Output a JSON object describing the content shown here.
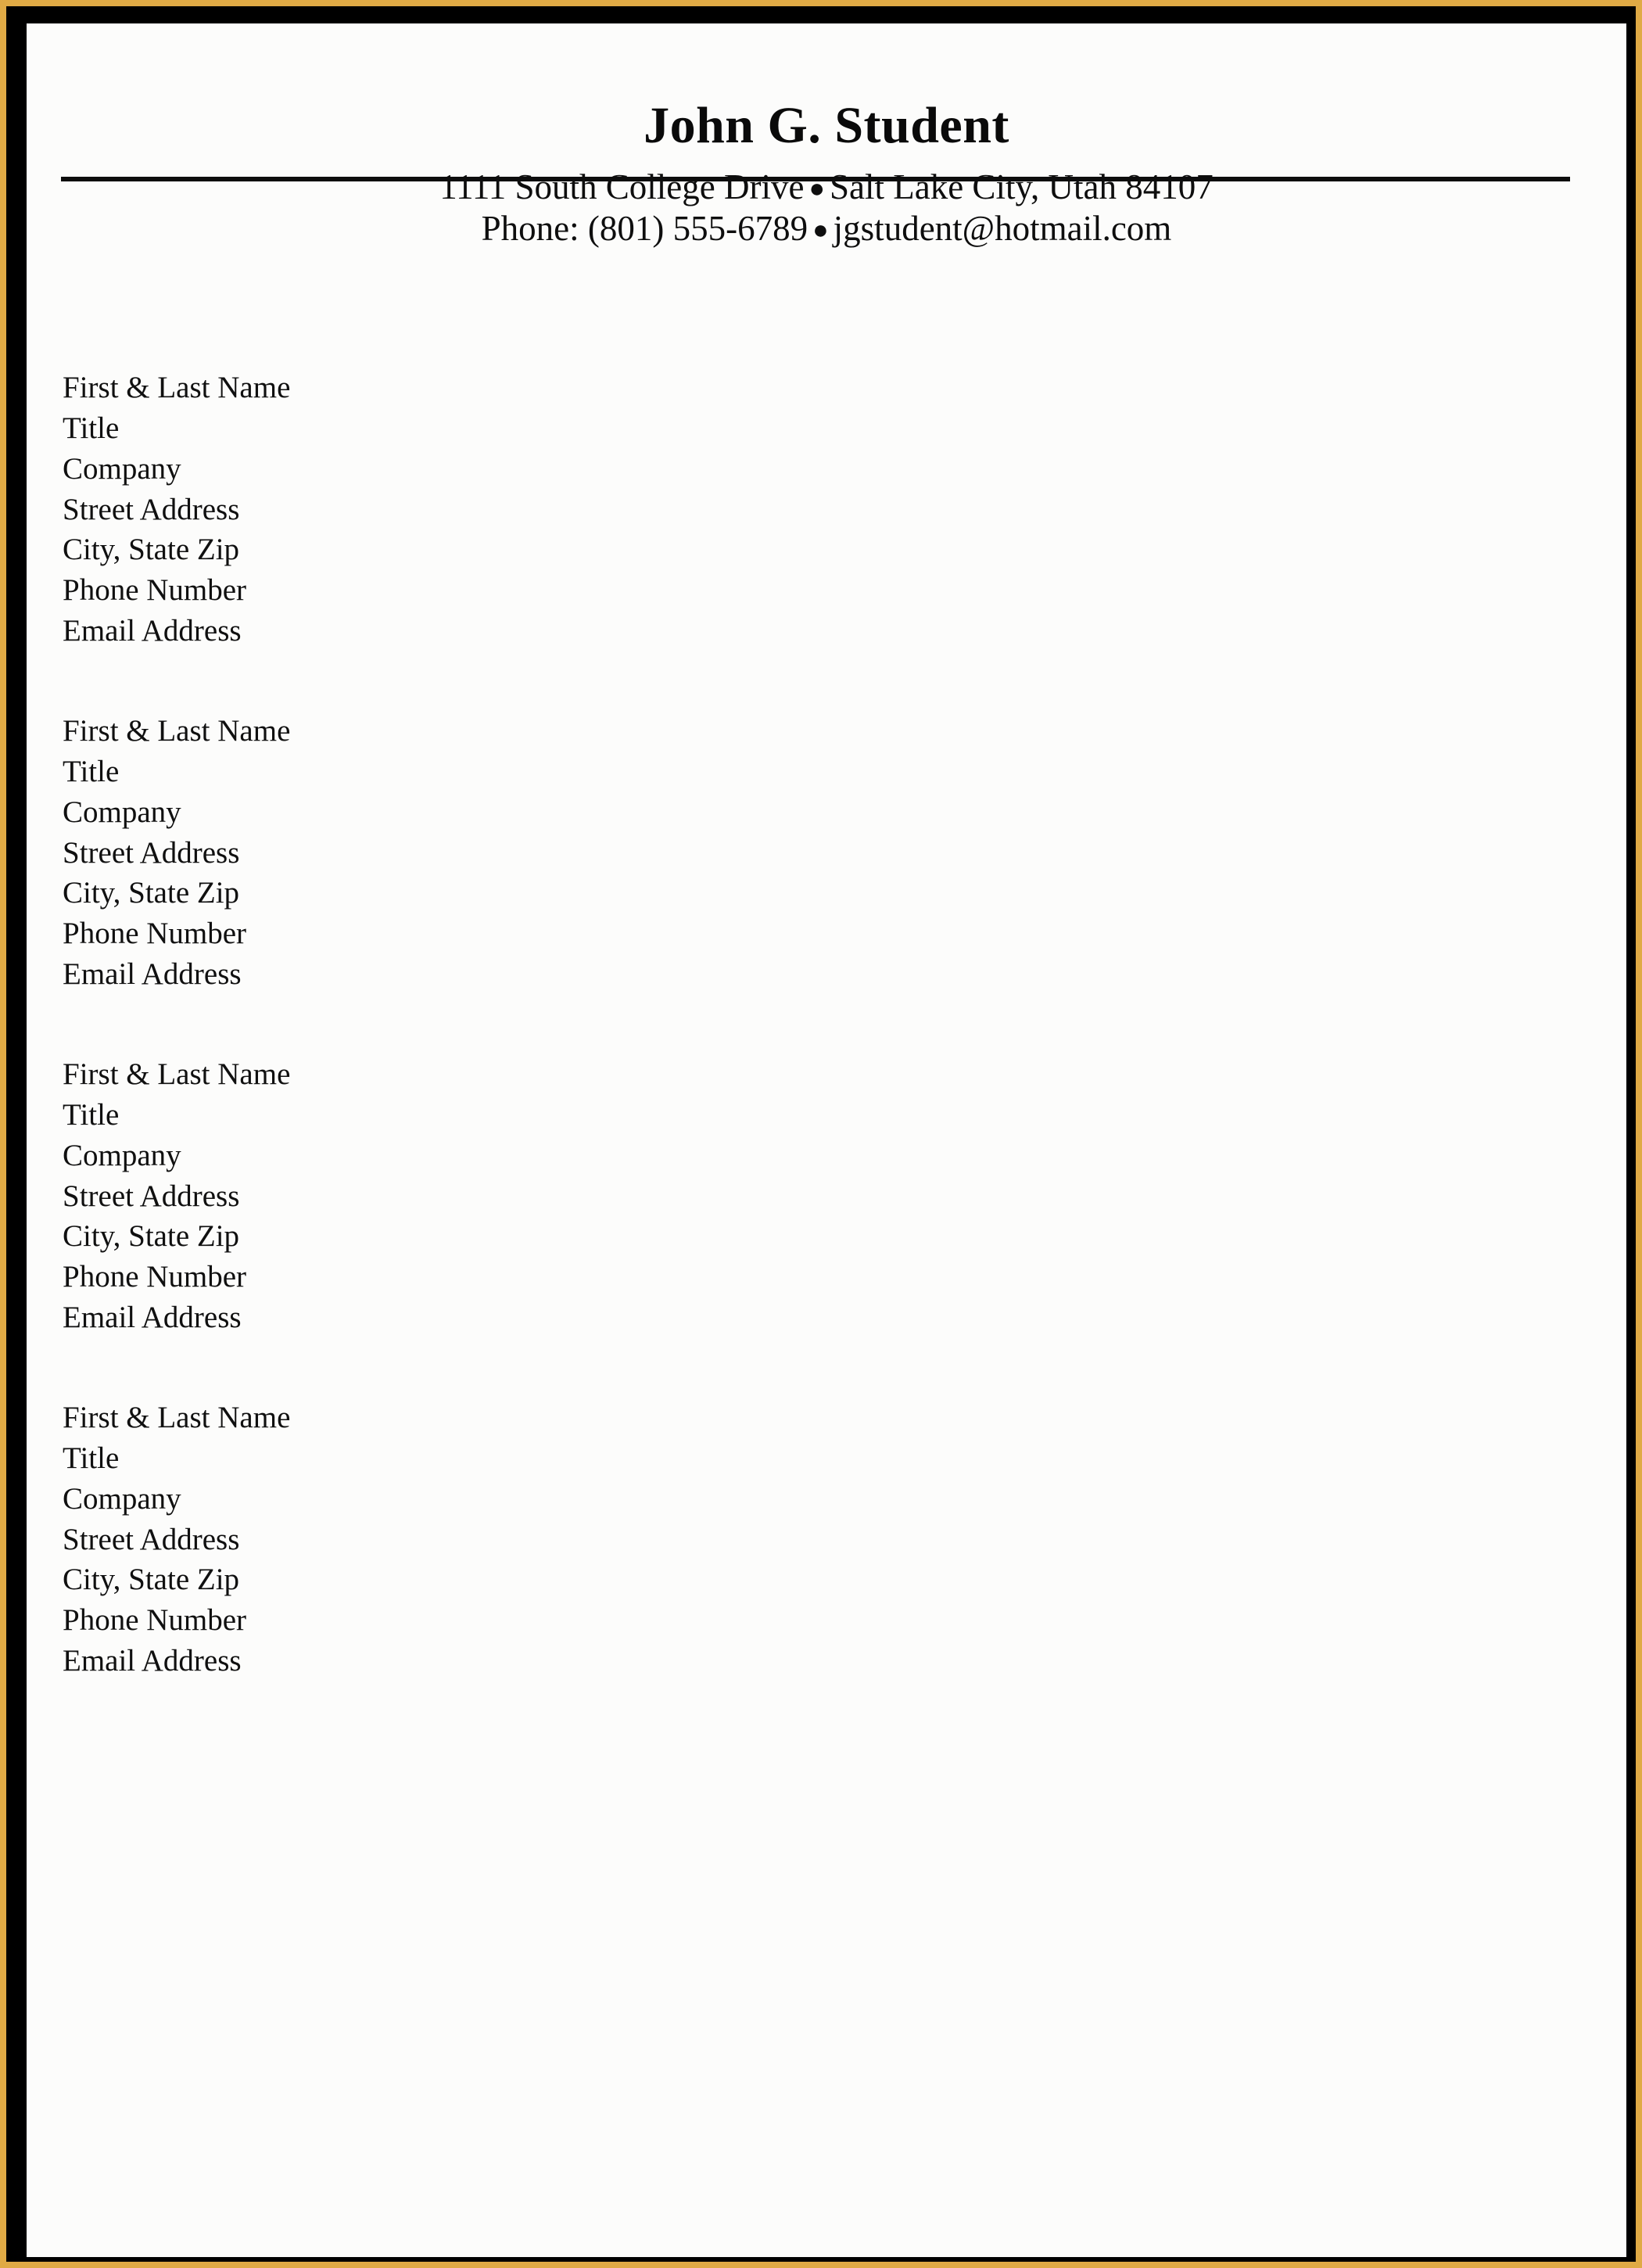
{
  "document": {
    "kind": "reference-page",
    "colors": {
      "frame_gold": "#e0aa45",
      "frame_black": "#000000",
      "sheet_white": "#fcfcfb",
      "text_black": "#101010"
    }
  },
  "letterhead": {
    "name": "John G. Student",
    "contact_lines": [
      {
        "left": "1111 South College Drive",
        "separator": "●",
        "right": "Salt Lake City, Utah 84107"
      },
      {
        "left": "Phone: (801) 555-6789",
        "separator": "●",
        "right": "jgstudent@hotmail.com"
      }
    ]
  },
  "references": {
    "field_labels": [
      "First & Last Name",
      "Title",
      "Company",
      "Street Address",
      "City, State Zip",
      "Phone Number",
      "Email Address"
    ],
    "blocks": [
      {
        "index": 1,
        "lines": [
          "First & Last Name",
          "Title",
          "Company",
          "Street Address",
          "City, State Zip",
          "Phone Number",
          "Email Address"
        ]
      },
      {
        "index": 2,
        "lines": [
          "First & Last Name",
          "Title",
          "Company",
          "Street Address",
          "City, State Zip",
          "Phone Number",
          "Email Address"
        ]
      },
      {
        "index": 3,
        "lines": [
          "First & Last Name",
          "Title",
          "Company",
          "Street Address",
          "City, State Zip",
          "Phone Number",
          "Email Address"
        ]
      },
      {
        "index": 4,
        "lines": [
          "First & Last Name",
          "Title",
          "Company",
          "Street Address",
          "City, State Zip",
          "Phone Number",
          "Email Address"
        ]
      }
    ]
  }
}
